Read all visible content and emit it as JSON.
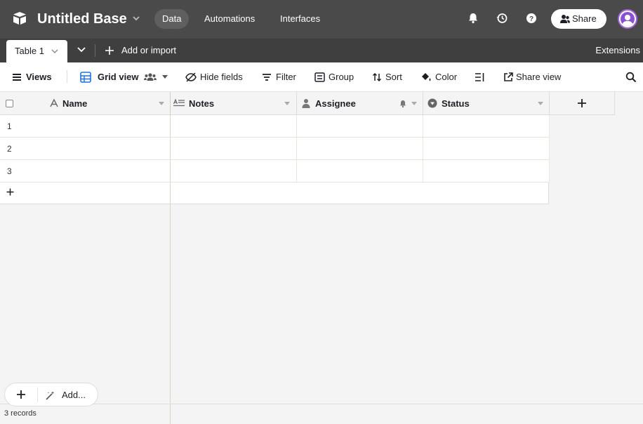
{
  "app": {
    "base_title": "Untitled Base",
    "nav": [
      {
        "label": "Data",
        "active": true
      },
      {
        "label": "Automations",
        "active": false
      },
      {
        "label": "Interfaces",
        "active": false
      }
    ],
    "share_label": "Share"
  },
  "tabs": {
    "active_table": "Table 1",
    "add_or_import": "Add or import",
    "extensions": "Extensions"
  },
  "toolbar": {
    "views": "Views",
    "grid_view": "Grid view",
    "hide_fields": "Hide fields",
    "filter": "Filter",
    "group": "Group",
    "sort": "Sort",
    "color": "Color",
    "share_view": "Share view"
  },
  "grid": {
    "columns": [
      {
        "label": "Name",
        "icon": "text-a-icon"
      },
      {
        "label": "Notes",
        "icon": "long-text-icon"
      },
      {
        "label": "Assignee",
        "icon": "user-icon"
      },
      {
        "label": "Status",
        "icon": "single-select-icon"
      }
    ],
    "rows": [
      {
        "number": "1"
      },
      {
        "number": "2"
      },
      {
        "number": "3"
      }
    ]
  },
  "footer": {
    "records": "3 records",
    "add_label": "Add..."
  },
  "colors": {
    "topbar": "#4a4a4a",
    "tabbar": "#3f3f3f",
    "grid_icon": "#1a73e8",
    "avatar": "#8b4fd1"
  }
}
